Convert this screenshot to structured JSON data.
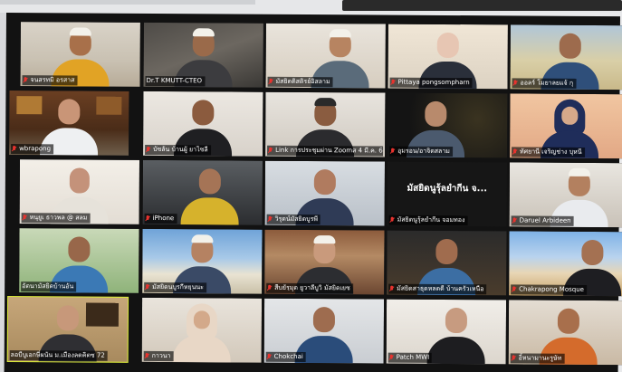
{
  "meeting": {
    "app": "Zoom",
    "view": "gallery",
    "colors": {
      "muted_icon": "#e8332e",
      "active_speaker_border": "#d9e83a",
      "label_bg": "rgba(0,0,0,0.62)"
    }
  },
  "participants": [
    {
      "name": "จนสรทมิ อรสาส",
      "muted": true
    },
    {
      "name": "Dr.T KMUTT-CTEO",
      "muted": false
    },
    {
      "name": "มัสยิดดิสติรย์อิสลาม",
      "muted": true
    },
    {
      "name": "Pittaya pongsompharn",
      "muted": true
    },
    {
      "name": "ออลร์ โมยาลยแจ้ กุ",
      "muted": true
    },
    {
      "name": "wbrapong",
      "muted": true
    },
    {
      "name": "บัซล้น บ้านผู้ ยาไซลี",
      "muted": true
    },
    {
      "name": "Link การประชุมผ่าน Zoomส 4 มี.ค. 66...",
      "muted": true
    },
    {
      "name": "อุมรอน/อาจิตสลาม",
      "muted": true
    },
    {
      "name": "ทัศยานี เจริญช่าง บุหนี",
      "muted": true
    },
    {
      "name": "หนุยูเ ธาวพล @ สลม",
      "muted": true
    },
    {
      "name": "iPhone",
      "muted": true
    },
    {
      "name": "วิรุตน์มัสยิดบูรพี",
      "muted": true
    },
    {
      "name": "มัสยิดนูรุ้ลยำกีน จอมทอง",
      "muted": true,
      "video_off_text": "มัสยิดนูรุ้ลยำกีน จ..."
    },
    {
      "name": "Daruel Arbideen",
      "muted": true
    },
    {
      "name": "อัตนามัสยิดบ้านอัน",
      "muted": false
    },
    {
      "name": "มัสยิดนบูรกีหยุนนะ",
      "muted": true
    },
    {
      "name": "สืบยัรฺมุต ยูวาลีบูวิ มัสยิดเยซ",
      "muted": true
    },
    {
      "name": "มัสยิดสาธุดหลดดี บ้านครัวเหนือ",
      "muted": true
    },
    {
      "name": "Chakrapong Mosque",
      "muted": true
    },
    {
      "name": "ลอบีบูเอกษี่ผนัน ม.เมืองลดคิตซ 72",
      "muted": false
    },
    {
      "name": "กาวนา",
      "muted": true
    },
    {
      "name": "Chokchai",
      "muted": true
    },
    {
      "name": "Patch MWI",
      "muted": true
    },
    {
      "name": "อิ้หนามานะรูษัท",
      "muted": true
    }
  ]
}
